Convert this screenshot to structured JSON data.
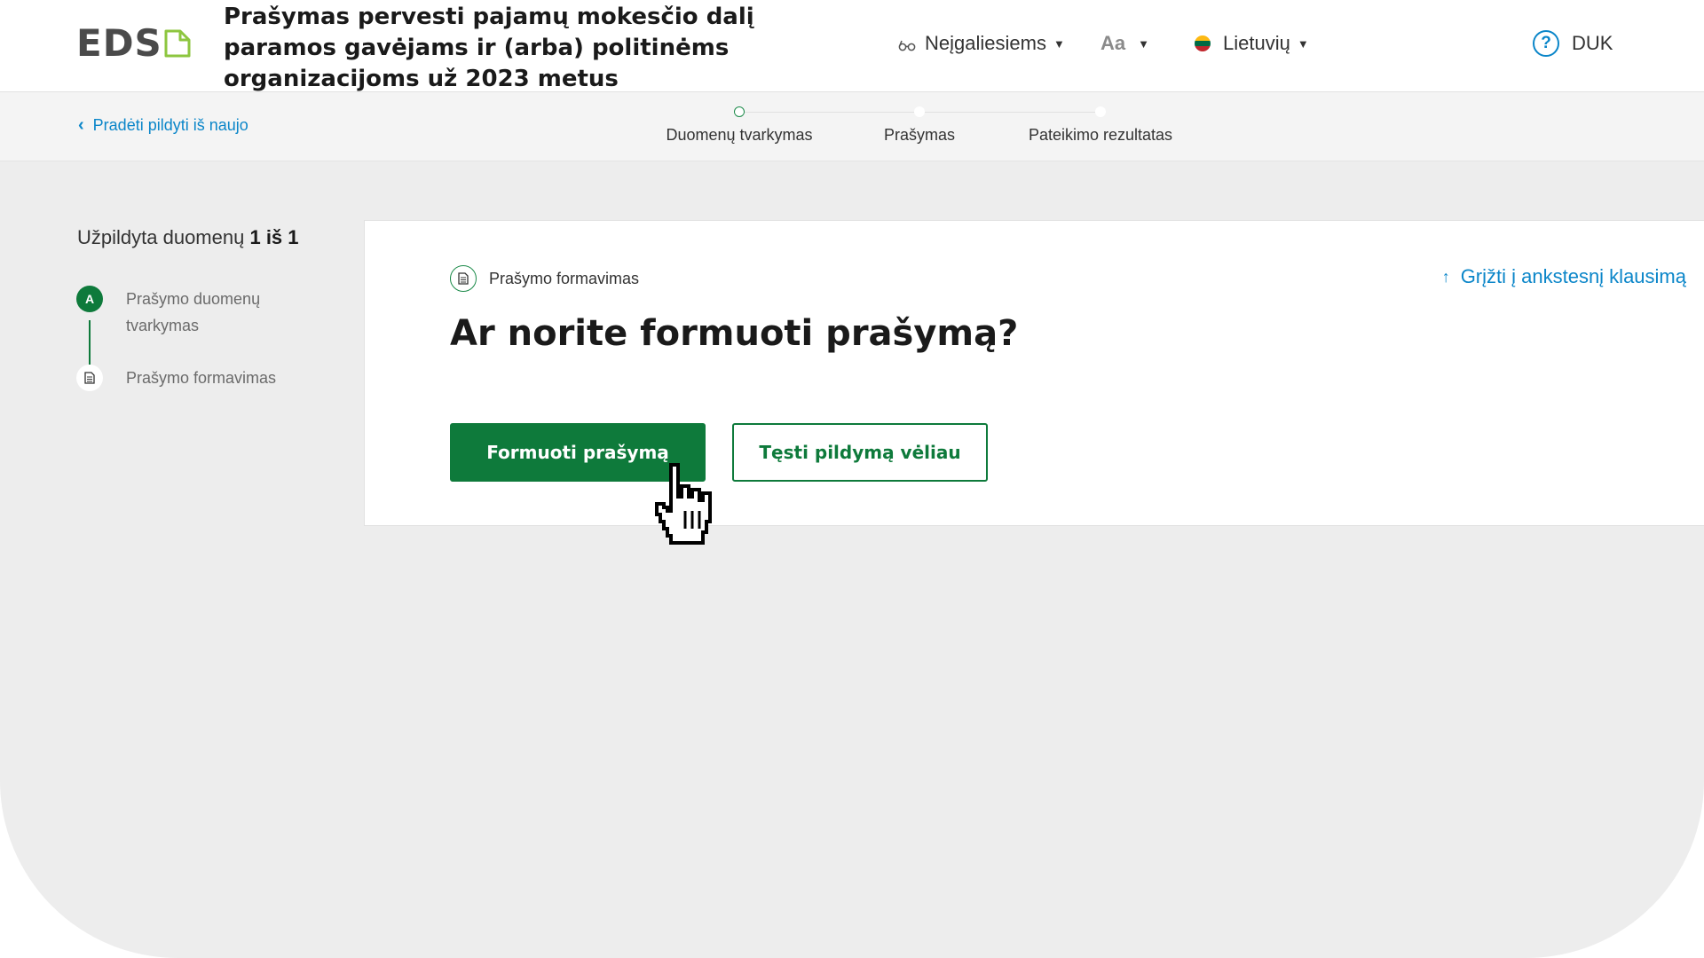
{
  "header": {
    "logo_text": "EDS",
    "title": "Prašymas pervesti pajamų mokesčio dalį paramos gavėjams ir (arba) politinėms organizacijoms už 2023 metus",
    "accessibility_label": "Neįgaliesiems",
    "font_size_label": "Aa",
    "language_label": "Lietuvių",
    "faq_label": "DUK",
    "icons": {
      "accessibility": "glasses-icon",
      "language": "lithuania-flag-icon",
      "faq": "question-circle-icon"
    },
    "flag_colors": [
      "#fdb913",
      "#006a44",
      "#c1272d"
    ]
  },
  "subheader": {
    "back_link": "Pradėti pildyti iš naujo",
    "steps": [
      {
        "label": "Duomenų tvarkymas",
        "active": true
      },
      {
        "label": "Prašymas",
        "active": false
      },
      {
        "label": "Pateikimo rezultatas",
        "active": false
      }
    ]
  },
  "sidebar": {
    "progress_prefix": "Užpildyta duomenų",
    "progress_count": "1 iš 1",
    "items": [
      {
        "badge": "A",
        "label": "Prašymo duomenų tvarkymas"
      },
      {
        "badge_icon": "document-icon",
        "label": "Prašymo formavimas"
      }
    ]
  },
  "main": {
    "section_label": "Prašymo formavimas",
    "go_back": "Grįžti į ankstesnį klausimą",
    "question": "Ar norite formuoti prašymą?",
    "primary_button": "Formuoti prašymą",
    "secondary_button": "Tęsti pildymą vėliau"
  },
  "colors": {
    "brand_green": "#0e7a3b",
    "link_blue": "#0b86c9",
    "logo_green": "#8dc63f",
    "background": "#ededed"
  }
}
